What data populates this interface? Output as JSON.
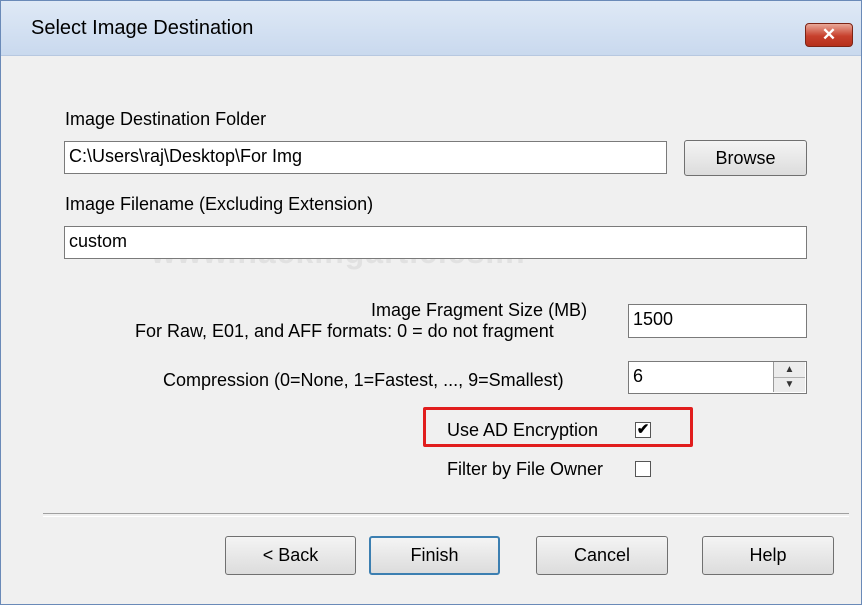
{
  "window": {
    "title": "Select Image Destination",
    "close_glyph": "✕"
  },
  "watermark": "www.hackingarticles.in",
  "destination": {
    "label": "Image Destination Folder",
    "value": "C:\\Users\\raj\\Desktop\\For Img",
    "browse_label": "Browse"
  },
  "filename": {
    "label": "Image Filename (Excluding Extension)",
    "value": "custom"
  },
  "fragment": {
    "label_line1": "Image Fragment Size (MB)",
    "label_line2": "For Raw, E01, and AFF formats: 0 = do not fragment",
    "value": "1500"
  },
  "compression": {
    "label": "Compression (0=None, 1=Fastest, ..., 9=Smallest)",
    "value": "6",
    "up_glyph": "▲",
    "down_glyph": "▼"
  },
  "encryption": {
    "label": "Use AD Encryption",
    "checked_glyph": "✔"
  },
  "filter_owner": {
    "label": "Filter by File Owner"
  },
  "buttons": {
    "back": "< Back",
    "finish": "Finish",
    "cancel": "Cancel",
    "help": "Help"
  },
  "colors": {
    "highlight_border": "#e11d1d",
    "close_button": "#c7402d",
    "default_button_border": "#3c7fb1"
  }
}
